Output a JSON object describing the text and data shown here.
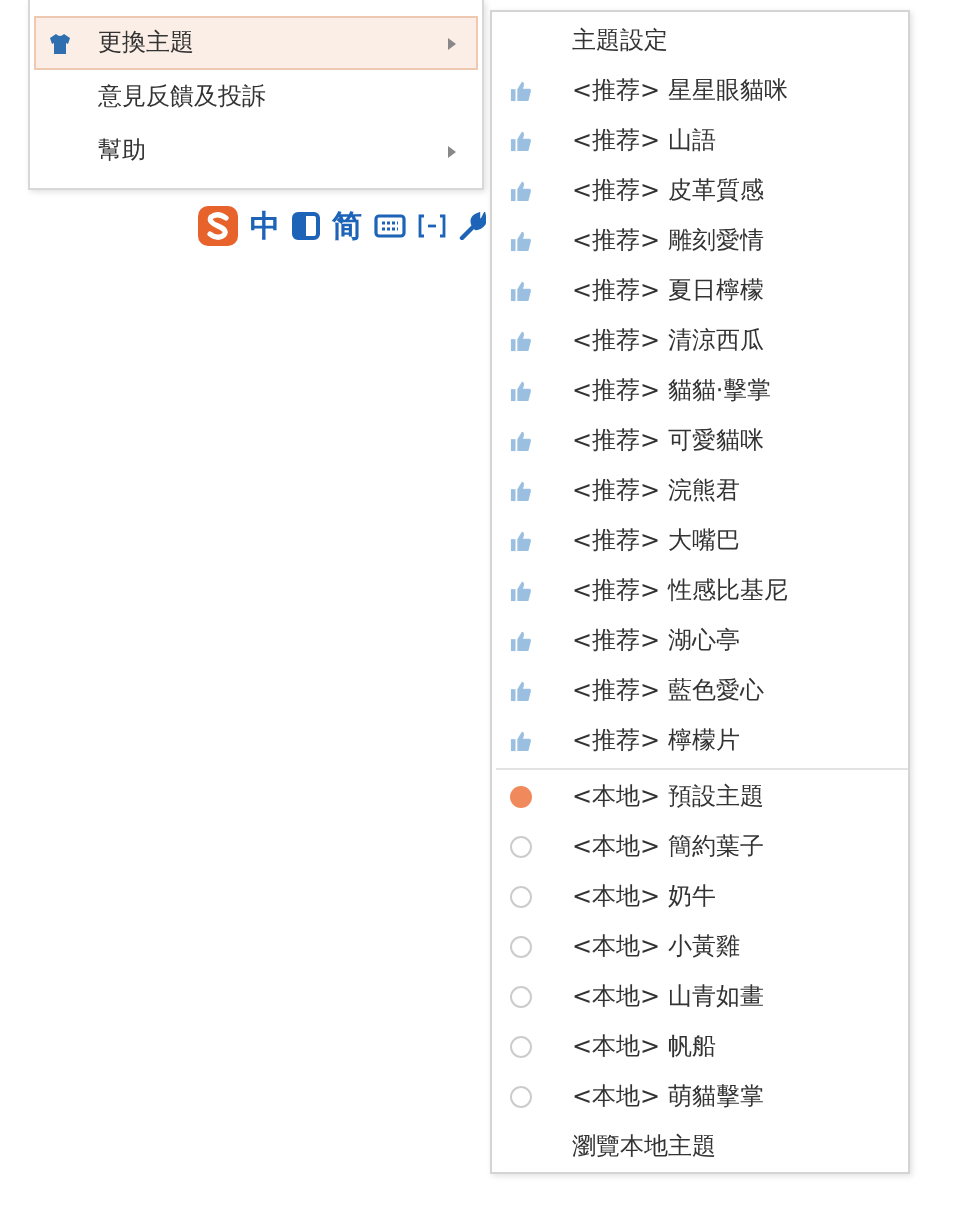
{
  "main_menu": {
    "items": [
      {
        "kind": "with_icon",
        "label": "更換主題",
        "selected": true,
        "submenu": true
      },
      {
        "kind": "plain",
        "label": "意見反饋及投訴",
        "selected": false,
        "submenu": false
      },
      {
        "kind": "plain",
        "label": "幫助",
        "selected": false,
        "submenu": true
      }
    ]
  },
  "toolbar": [
    {
      "kind": "logo"
    },
    {
      "kind": "text",
      "label": "中"
    },
    {
      "kind": "halfmoon"
    },
    {
      "kind": "text",
      "label": "简"
    },
    {
      "kind": "keyboard"
    },
    {
      "kind": "symbol"
    },
    {
      "kind": "wrench"
    }
  ],
  "theme_menu": {
    "header": "主題設定",
    "recommended": [
      {
        "tag": "<推荐>",
        "name": "星星眼貓咪"
      },
      {
        "tag": "<推荐>",
        "name": "山語"
      },
      {
        "tag": "<推荐>",
        "name": "皮革質感"
      },
      {
        "tag": "<推荐>",
        "name": "雕刻愛情"
      },
      {
        "tag": "<推荐>",
        "name": "夏日檸檬"
      },
      {
        "tag": "<推荐>",
        "name": "清涼西瓜"
      },
      {
        "tag": "<推荐>",
        "name": "貓貓·擊掌"
      },
      {
        "tag": "<推荐>",
        "name": "可愛貓咪"
      },
      {
        "tag": "<推荐>",
        "name": "浣熊君"
      },
      {
        "tag": "<推荐>",
        "name": "大嘴巴"
      },
      {
        "tag": "<推荐>",
        "name": "性感比基尼"
      },
      {
        "tag": "<推荐>",
        "name": "湖心亭"
      },
      {
        "tag": "<推荐>",
        "name": "藍色愛心"
      },
      {
        "tag": "<推荐>",
        "name": "檸檬片"
      }
    ],
    "local": [
      {
        "tag": "<本地>",
        "name": "預設主題",
        "selected": true
      },
      {
        "tag": "<本地>",
        "name": "簡約葉子",
        "selected": false
      },
      {
        "tag": "<本地>",
        "name": "奶牛",
        "selected": false
      },
      {
        "tag": "<本地>",
        "name": "小黃雞",
        "selected": false
      },
      {
        "tag": "<本地>",
        "name": "山青如畫",
        "selected": false
      },
      {
        "tag": "<本地>",
        "name": "帆船",
        "selected": false
      },
      {
        "tag": "<本地>",
        "name": "萌貓擊掌",
        "selected": false
      }
    ],
    "footer": "瀏覽本地主題"
  }
}
